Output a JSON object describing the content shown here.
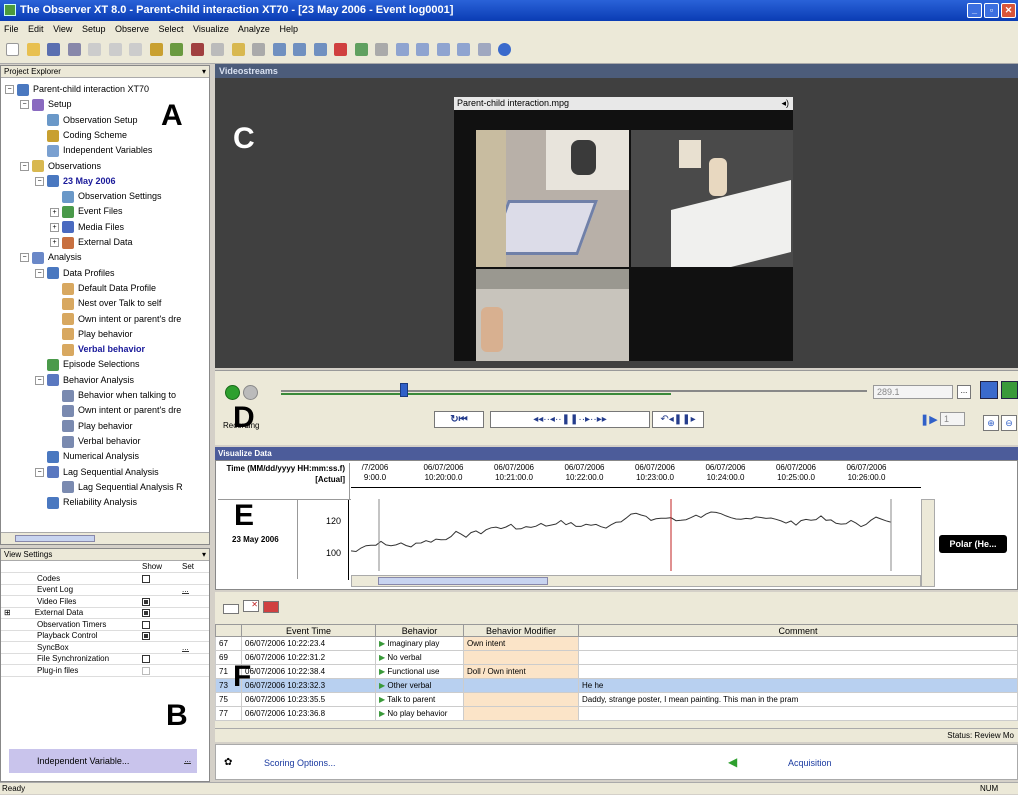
{
  "window": {
    "title": "The Observer XT 8.0 - Parent-child interaction XT70 - [23 May 2006 - Event log0001]"
  },
  "menu": [
    "File",
    "Edit",
    "View",
    "Setup",
    "Observe",
    "Select",
    "Visualize",
    "Analyze",
    "Help"
  ],
  "project_explorer": {
    "title": "Project Explorer",
    "tree": [
      {
        "label": "Parent-child interaction XT70",
        "level": 0,
        "exp": "−",
        "icon": "project-icon"
      },
      {
        "label": "Setup",
        "level": 1,
        "exp": "−",
        "icon": "setup-icon"
      },
      {
        "label": "Observation Setup",
        "level": 2,
        "exp": "",
        "icon": "observation-setup-icon"
      },
      {
        "label": "Coding Scheme",
        "level": 2,
        "exp": "",
        "icon": "coding-scheme-icon"
      },
      {
        "label": "Independent Variables",
        "level": 2,
        "exp": "",
        "icon": "independent-variables-icon"
      },
      {
        "label": "Observations",
        "level": 1,
        "exp": "−",
        "icon": "folder-icon"
      },
      {
        "label": "23 May 2006",
        "level": 2,
        "exp": "−",
        "icon": "observation-icon",
        "bold": true
      },
      {
        "label": "Observation Settings",
        "level": 3,
        "exp": "",
        "icon": "settings-icon"
      },
      {
        "label": "Event Files",
        "level": 3,
        "exp": "+",
        "icon": "event-files-icon"
      },
      {
        "label": "Media Files",
        "level": 3,
        "exp": "+",
        "icon": "media-files-icon"
      },
      {
        "label": "External Data",
        "level": 3,
        "exp": "+",
        "icon": "external-data-icon"
      },
      {
        "label": "Analysis",
        "level": 1,
        "exp": "−",
        "icon": "analysis-icon"
      },
      {
        "label": "Data Profiles",
        "level": 2,
        "exp": "−",
        "icon": "data-profiles-icon"
      },
      {
        "label": "Default Data Profile",
        "level": 3,
        "exp": "",
        "icon": "data-profile-icon"
      },
      {
        "label": "Nest over Talk to self",
        "level": 3,
        "exp": "",
        "icon": "data-profile-icon"
      },
      {
        "label": "Own intent or parent's dre",
        "level": 3,
        "exp": "",
        "icon": "data-profile-icon"
      },
      {
        "label": "Play behavior",
        "level": 3,
        "exp": "",
        "icon": "data-profile-icon"
      },
      {
        "label": "Verbal behavior",
        "level": 3,
        "exp": "",
        "icon": "data-profile-icon",
        "bold": true
      },
      {
        "label": "Episode Selections",
        "level": 2,
        "exp": "",
        "icon": "episode-icon"
      },
      {
        "label": "Behavior Analysis",
        "level": 2,
        "exp": "−",
        "icon": "behavior-analysis-icon"
      },
      {
        "label": "Behavior when talking to",
        "level": 3,
        "exp": "",
        "icon": "analysis-doc-icon"
      },
      {
        "label": "Own intent or parent's dre",
        "level": 3,
        "exp": "",
        "icon": "analysis-doc-icon"
      },
      {
        "label": "Play behavior",
        "level": 3,
        "exp": "",
        "icon": "analysis-doc-icon"
      },
      {
        "label": "Verbal behavior",
        "level": 3,
        "exp": "",
        "icon": "analysis-doc-icon"
      },
      {
        "label": "Numerical Analysis",
        "level": 2,
        "exp": "",
        "icon": "numerical-icon"
      },
      {
        "label": "Lag Sequential Analysis",
        "level": 2,
        "exp": "−",
        "icon": "lag-icon"
      },
      {
        "label": "Lag Sequential Analysis R",
        "level": 3,
        "exp": "",
        "icon": "lag-doc-icon"
      },
      {
        "label": "Reliability Analysis",
        "level": 2,
        "exp": "",
        "icon": "reliability-icon"
      }
    ]
  },
  "view_settings": {
    "title": "View Settings",
    "col_show": "Show",
    "col_set": "Set",
    "rows": [
      {
        "label": "Codes",
        "show": "off",
        "set": false,
        "plus": false
      },
      {
        "label": "Event Log",
        "show": "none",
        "set": true,
        "plus": false
      },
      {
        "label": "Video Files",
        "show": "on",
        "set": false,
        "plus": false
      },
      {
        "label": "External Data",
        "show": "on",
        "set": false,
        "plus": true
      },
      {
        "label": "Observation Timers",
        "show": "off",
        "set": false,
        "plus": false
      },
      {
        "label": "Playback Control",
        "show": "on",
        "set": false,
        "plus": false
      },
      {
        "label": "SyncBox",
        "show": "none",
        "set": true,
        "plus": false
      },
      {
        "label": "File Synchronization",
        "show": "off",
        "set": false,
        "plus": false
      },
      {
        "label": "Plug-in files",
        "show": "disabled",
        "set": false,
        "plus": false
      }
    ],
    "indep_var": "Independent Variable..."
  },
  "labels": {
    "A": "A",
    "B": "B",
    "C": "C",
    "D": "D",
    "E": "E",
    "F": "F"
  },
  "videostreams": {
    "title": "Videostreams",
    "file": "Parent-child interaction.mpg"
  },
  "playback": {
    "time": "289.1",
    "recording": "Recording",
    "step": "1"
  },
  "visualize": {
    "title": "Visualize Data",
    "axis_label": "Time (MM/dd/yyyy HH:mm:ss.f) [Actual]",
    "ticks": [
      {
        "date": "/7/2006",
        "time": "9:00.0"
      },
      {
        "date": "06/07/2006",
        "time": "10:20:00.0"
      },
      {
        "date": "06/07/2006",
        "time": "10:21:00.0"
      },
      {
        "date": "06/07/2006",
        "time": "10:22:00.0"
      },
      {
        "date": "06/07/2006",
        "time": "10:23:00.0"
      },
      {
        "date": "06/07/2006",
        "time": "10:24:00.0"
      },
      {
        "date": "06/07/2006",
        "time": "10:25:00.0"
      },
      {
        "date": "06/07/2006",
        "time": "10:26:00.0"
      },
      {
        "date": "06/07/:",
        "time": "10:27:("
      }
    ],
    "row_label": "23 May 2006",
    "y_ticks": [
      "120",
      "100"
    ],
    "series_name": "Polar (He..."
  },
  "event_log": {
    "columns": [
      "",
      "Event Time",
      "Behavior",
      "Behavior Modifier",
      "Comment"
    ],
    "rows": [
      {
        "no": "67",
        "time": "06/07/2006 10:22:23.4",
        "behavior": "Imaginary play",
        "modifier": "Own intent",
        "comment": "",
        "mod_bg": true,
        "sel": false
      },
      {
        "no": "69",
        "time": "06/07/2006 10:22:31.2",
        "behavior": "No verbal",
        "modifier": "",
        "comment": "",
        "mod_bg": true,
        "sel": false
      },
      {
        "no": "71",
        "time": "06/07/2006 10:22:38.4",
        "behavior": "Functional use",
        "modifier": "Doll / Own intent",
        "comment": "",
        "mod_bg": true,
        "sel": false
      },
      {
        "no": "73",
        "time": "06/07/2006 10:23:32.3",
        "behavior": "Other verbal",
        "modifier": "",
        "comment": "He he",
        "mod_bg": true,
        "sel": true
      },
      {
        "no": "75",
        "time": "06/07/2006 10:23:35.5",
        "behavior": "Talk to parent",
        "modifier": "",
        "comment": "Daddy, strange poster, I mean painting. This man in the pram",
        "mod_bg": true,
        "sel": false
      },
      {
        "no": "77",
        "time": "06/07/2006 10:23:36.8",
        "behavior": "No play behavior",
        "modifier": "",
        "comment": "",
        "mod_bg": true,
        "sel": false
      }
    ]
  },
  "status": {
    "review": "Status: Review Mo",
    "ready": "Ready",
    "num": "NUM"
  },
  "scoring": {
    "options": "Scoring Options...",
    "acquisition": "Acquisition"
  }
}
